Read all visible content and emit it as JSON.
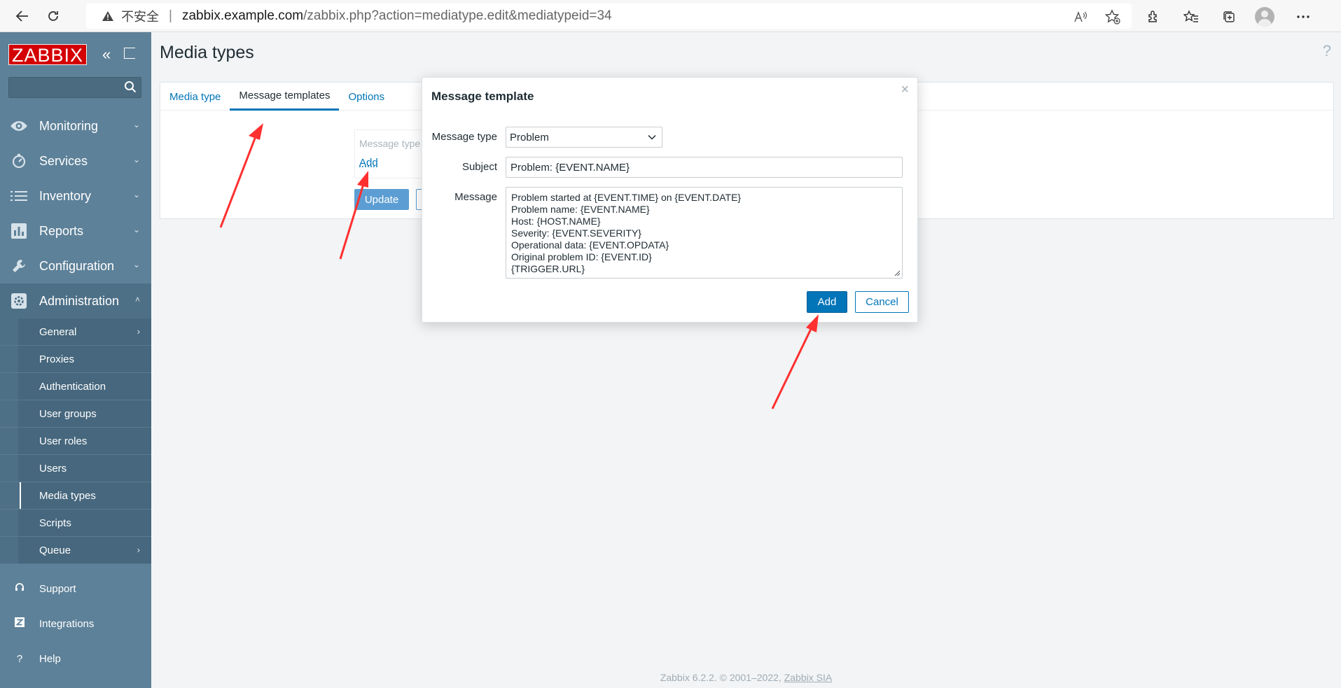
{
  "browser": {
    "insecure_label": "不安全",
    "url_host": "zabbix.example.com",
    "url_path": "/zabbix.php?action=mediatype.edit&mediatypeid=34"
  },
  "sidebar": {
    "logo": "ZABBIX",
    "menu": [
      {
        "label": "Monitoring",
        "icon": "eye-icon"
      },
      {
        "label": "Services",
        "icon": "clock-icon"
      },
      {
        "label": "Inventory",
        "icon": "list-icon"
      },
      {
        "label": "Reports",
        "icon": "bar-chart-icon"
      },
      {
        "label": "Configuration",
        "icon": "wrench-icon"
      },
      {
        "label": "Administration",
        "icon": "gear-icon"
      }
    ],
    "admin_items": [
      "General",
      "Proxies",
      "Authentication",
      "User groups",
      "User roles",
      "Users",
      "Media types",
      "Scripts",
      "Queue"
    ],
    "bottom": [
      {
        "label": "Support",
        "icon": "headset-icon"
      },
      {
        "label": "Integrations",
        "icon": "z-icon"
      },
      {
        "label": "Help",
        "icon": "question-icon"
      }
    ]
  },
  "main": {
    "title": "Media types",
    "help": "?",
    "tabs": [
      "Media type",
      "Message templates",
      "Options"
    ],
    "template_header": "Message type",
    "add_link": "Add",
    "update_button": "Update"
  },
  "modal": {
    "title": "Message template",
    "message_type_label": "Message type",
    "message_type_value": "Problem",
    "subject_label": "Subject",
    "subject_value": "Problem: {EVENT.NAME}",
    "message_label": "Message",
    "message_lines": [
      "Problem started at {EVENT.TIME} on {EVENT.DATE}",
      "Problem name: {EVENT.NAME}",
      "Host: {HOST.NAME}",
      "Severity: {EVENT.SEVERITY}",
      "Operational data: {EVENT.OPDATA}",
      "Original problem ID: {EVENT.ID}",
      "{TRIGGER.URL}"
    ],
    "add_button": "Add",
    "cancel_button": "Cancel"
  },
  "footer": {
    "text": "Zabbix 6.2.2. © 2001–2022, ",
    "link": "Zabbix SIA"
  },
  "colors": {
    "sidebar_bg": "#5d8198",
    "accent_blue": "#0275b8",
    "logo_red": "#d40000",
    "annotation_arrow": "#ff3030"
  }
}
